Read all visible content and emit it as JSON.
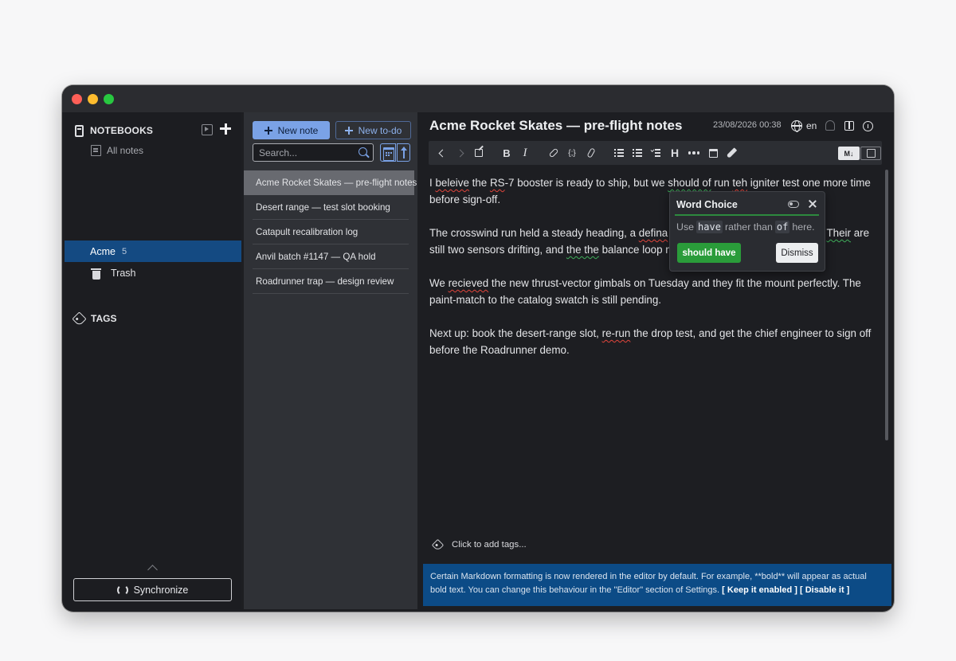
{
  "sidebar": {
    "notebooks_header": "NOTEBOOKS",
    "all_notes": "All notes",
    "notebook": {
      "name": "Acme",
      "count": "5"
    },
    "trash": "Trash",
    "tags_header": "TAGS",
    "sync_label": "Synchronize"
  },
  "notelist": {
    "new_note": "New note",
    "new_todo": "New to-do",
    "search_placeholder": "Search...",
    "items": [
      "Acme Rocket Skates — pre-flight notes",
      "Desert range — test slot booking",
      "Catapult recalibration log",
      "Anvil batch #1147 — QA hold",
      "Roadrunner trap — design review"
    ]
  },
  "editor": {
    "title": "Acme Rocket Skates — pre-flight notes",
    "date": "23/08/2026 00:38",
    "language": "en",
    "toolbar": {
      "bold": "B",
      "italic": "I",
      "code": "{;}",
      "heading": "H",
      "markdown": "M↓"
    },
    "body": {
      "p1": [
        "I ",
        "beleive",
        " the ",
        "RS",
        "-7 booster is ready to ship, but we ",
        "should of",
        " run ",
        "teh",
        " igniter test one more time before sign-off."
      ],
      "p2": [
        "The crosswind run held a steady heading, a ",
        "defina",
        "",
        "",
        ". ",
        "Their",
        " are still two sensors drifting, and ",
        "the the",
        " balance loop ",
        "n"
      ],
      "p3": [
        "We ",
        "recieved",
        " the new thrust-vector gimbals on Tuesday and they fit the mount perfectly. The paint-match to the catalog swatch is still pending."
      ],
      "p4": [
        "Next up: book the desert-range slot, ",
        "re-run",
        " the drop test, and get the chief engineer to sign off before the Roadrunner demo."
      ]
    },
    "add_tags": "Click to add tags...",
    "banner": {
      "text": "Certain Markdown formatting is now rendered in the editor by default. For example, **bold** will appear as actual bold text. You can change this behaviour in the \"Editor\" section of Settings.",
      "keep": "[ Keep it enabled ]",
      "disable": "[ Disable it ]"
    }
  },
  "popup": {
    "title": "Word Choice",
    "use": "Use",
    "suggested": "have",
    "rather": "rather than",
    "original": "of",
    "here": "here.",
    "apply_label": "should have",
    "dismiss_label": "Dismiss"
  },
  "colors": {
    "accent": "#7aa2e6",
    "selected_notebook": "#144a82",
    "banner": "#0c4b86",
    "apply_button": "#2a9c3a",
    "spelling_underline": "#e2453c",
    "grammar_underline": "#3fae5a"
  }
}
